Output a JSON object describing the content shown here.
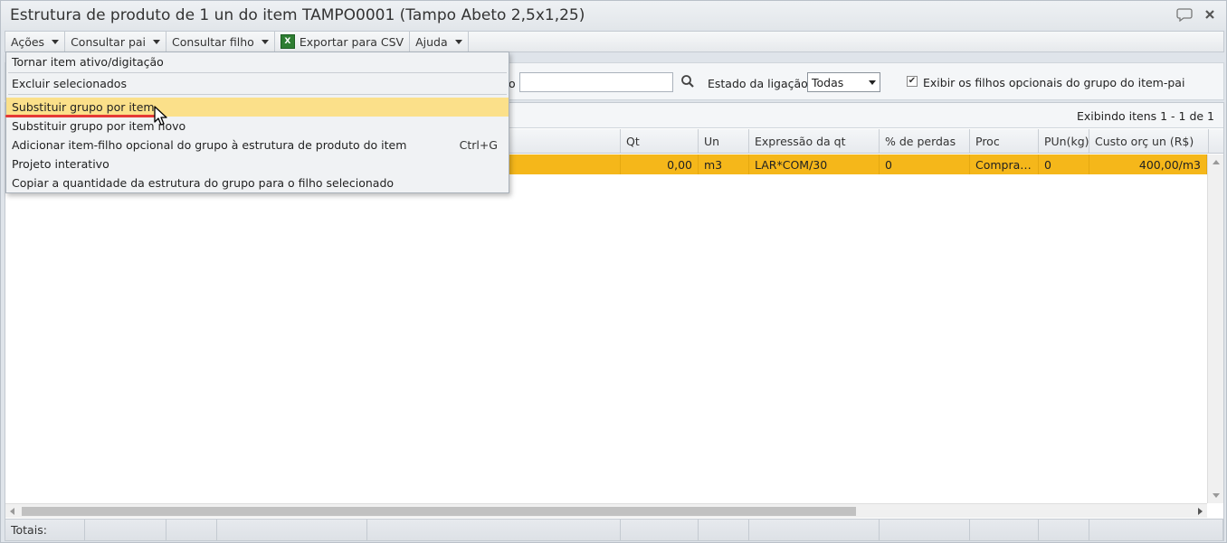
{
  "window": {
    "title": "Estrutura de produto de 1 un do item TAMPO0001 (Tampo Abeto 2,5x1,25)",
    "icons": [
      "chat-icon",
      "close-icon"
    ]
  },
  "toolbar": {
    "acoes": "Ações",
    "consultar_pai": "Consultar pai",
    "consultar_filho": "Consultar filho",
    "exportar_csv": "Exportar para CSV",
    "ajuda": "Ajuda"
  },
  "filters": {
    "search_value": "",
    "estado_label": "Estado da ligação",
    "estado_value": "Todas",
    "exibir_label": "Exibir os filhos opcionais do grupo do item-pai",
    "exibir_checked": true,
    "clipped_label_fragment": "o"
  },
  "grid": {
    "paging_text": "Exibindo itens 1 - 1 de 1",
    "columns": [
      "Qt",
      "Un",
      "Expressão da qt",
      "% de perdas",
      "Proc",
      "PUn(kg)",
      "Custo orç un (R$)"
    ],
    "rows": [
      {
        "qt": "0,00",
        "un": "m3",
        "expressao": "LAR*COM/30",
        "perdas": "0",
        "proc": "Compra…",
        "pun": "0",
        "custo": "400,00/m3"
      }
    ],
    "totals_label": "Totais:"
  },
  "menu": {
    "items": [
      {
        "label": "Tornar item ativo/digitação",
        "shortcut": ""
      },
      {
        "label": "Excluir selecionados",
        "shortcut": ""
      },
      {
        "label": "Substituir grupo por item",
        "shortcut": ""
      },
      {
        "label": "Substituir grupo por item novo",
        "shortcut": ""
      },
      {
        "label": "Adicionar item-filho opcional do grupo à estrutura de produto do item",
        "shortcut": "Ctrl+G"
      },
      {
        "label": "Projeto interativo",
        "shortcut": ""
      },
      {
        "label": "Copiar a quantidade da estrutura do grupo para o filho selecionado",
        "shortcut": ""
      }
    ],
    "active_index": 2
  },
  "colors": {
    "selected_row": "#f5b71a",
    "menu_highlight": "#fbe08a",
    "annotation_red": "#e53935"
  }
}
